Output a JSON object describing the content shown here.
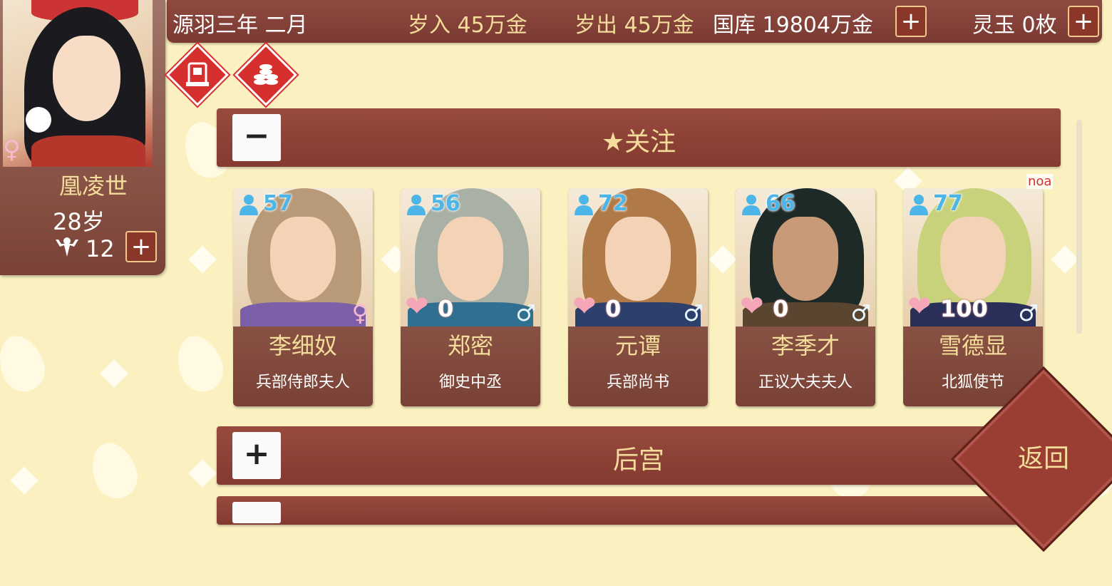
{
  "topbar": {
    "date": "源羽三年 二月",
    "income": "岁入 45万金",
    "expense": "岁出 45万金",
    "treasury": "国库 19804万金",
    "jade": "灵玉 0枚",
    "plus": "+"
  },
  "player": {
    "name": "凰凌世",
    "age": "28岁",
    "stamina": "12",
    "gender_symbol": "♀",
    "plus": "+"
  },
  "sections": {
    "favorites": {
      "toggle": "−",
      "title": "★关注"
    },
    "harem": {
      "toggle": "+",
      "title": "后宫"
    }
  },
  "characters": [
    {
      "name": "李细奴",
      "title": "兵部侍郎夫人",
      "stat": "57",
      "favor": "",
      "gender": "♀",
      "gender_type": "female",
      "hair": "#b99a78",
      "robe": "#7b5fa8"
    },
    {
      "name": "郑密",
      "title": "御史中丞",
      "stat": "56",
      "favor": "0",
      "gender": "♂",
      "gender_type": "male",
      "hair": "#a9b1a6",
      "robe": "#2f6f8f"
    },
    {
      "name": "元谭",
      "title": "兵部尚书",
      "stat": "72",
      "favor": "0",
      "gender": "♂",
      "gender_type": "male",
      "hair": "#b07a48",
      "robe": "#2d3f6b"
    },
    {
      "name": "李季才",
      "title": "正议大夫夫人",
      "stat": "66",
      "favor": "0",
      "gender": "♂",
      "gender_type": "male",
      "hair": "#1e2a28",
      "robe": "#5a4530"
    },
    {
      "name": "雪德显",
      "title": "北狐使节",
      "stat": "77",
      "favor": "100",
      "gender": "♂",
      "gender_type": "male",
      "hair": "#c8d27a",
      "robe": "#2a2f5a"
    }
  ],
  "corner_label": "noa",
  "return_label": "返回",
  "colors": {
    "accent": "#8a3628",
    "gold_text": "#f4dd9a",
    "stat_blue": "#4db6e8",
    "background": "#fbf1c0"
  },
  "icons": [
    "person-stat-icon",
    "heart-icon",
    "male-icon",
    "female-icon",
    "throne-icon",
    "coins-icon",
    "strength-icon"
  ]
}
